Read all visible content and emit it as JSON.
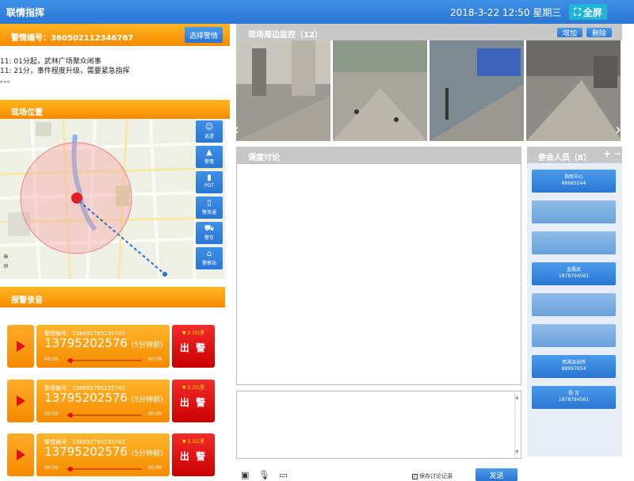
{
  "header": {
    "title": "联情指挥",
    "datetime": "2018-3-22  12:50 星期三",
    "fullscreen_label": "全屏"
  },
  "incident": {
    "number_label": "警情编号：360502112346767",
    "select_button": "选择警情",
    "log": [
      "11: 01分起，武林广场聚众闹事",
      "11: 21分，事件程度升级，需要紧急指挥",
      "。。。"
    ]
  },
  "location": {
    "title": "现场位置",
    "tools": [
      {
        "label": "巡逻",
        "icon": "person-icon",
        "glyph": "☺"
      },
      {
        "label": "警情",
        "icon": "alarm-icon",
        "glyph": "▲"
      },
      {
        "label": "PDT",
        "icon": "radio-icon",
        "glyph": "▮"
      },
      {
        "label": "警务通",
        "icon": "phone-icon",
        "glyph": "▯"
      },
      {
        "label": "警车",
        "icon": "car-icon",
        "glyph": "⛟"
      },
      {
        "label": "警察站",
        "icon": "station-icon",
        "glyph": "⌂"
      }
    ]
  },
  "recordings": {
    "title": "报警录音",
    "items": [
      {
        "number": "警情编号：158892795235742",
        "phone": "13795202576",
        "ago": "(5分钟前)",
        "start": "00:00",
        "end": "00:09",
        "distance": "▼ 2.3公里",
        "dispatch": "出 警",
        "progress": 0.05
      },
      {
        "number": "警情编号：158892795235742",
        "phone": "13795202576",
        "ago": "(5分钟前)",
        "start": "00:00",
        "end": "00:09",
        "distance": "▼ 2.3公里",
        "dispatch": "出 警",
        "progress": 0.05
      },
      {
        "number": "警情编号：158892795235742",
        "phone": "13795202576",
        "ago": "(5分钟前)",
        "start": "00:00",
        "end": "00:09",
        "distance": "▼ 2.3公里",
        "dispatch": "出 警",
        "progress": 0.05
      }
    ]
  },
  "monitor": {
    "title": "现场周边监控（12）",
    "add_label": "增加",
    "delete_label": "删除"
  },
  "discussion": {
    "title": "调度讨论",
    "save_label": "保存讨论记录",
    "send_label": "发送"
  },
  "participants": {
    "title": "参会人员（8）",
    "add": "+",
    "remove": "−",
    "list": [
      {
        "name": "指挥中心",
        "phone": "88665544",
        "online": true
      },
      {
        "name": "",
        "phone": "",
        "online": false
      },
      {
        "name": "",
        "phone": "",
        "online": false
      },
      {
        "name": "金晨武",
        "phone": "1878794561",
        "online": true
      },
      {
        "name": "",
        "phone": "",
        "online": false
      },
      {
        "name": "",
        "phone": "",
        "online": false
      },
      {
        "name": "西湖派出所",
        "phone": "88997654",
        "online": true
      },
      {
        "name": "杨 言",
        "phone": "1878794561",
        "online": true
      }
    ]
  },
  "colors": {
    "header_blue": "#2a76d4",
    "accent_orange": "#f58a00",
    "alert_red": "#e01010"
  }
}
